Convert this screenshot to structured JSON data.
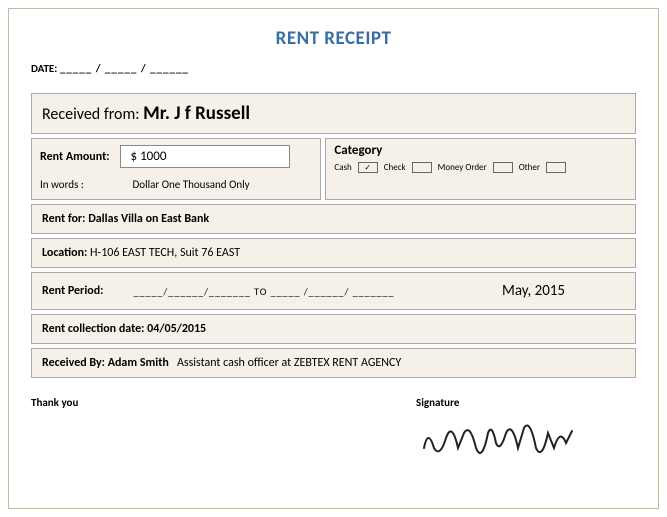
{
  "title": "RENT RECEIPT",
  "date_label": "DATE:",
  "date_blanks": "_____ / _____ / ______",
  "received_from": {
    "label": "Received from:",
    "value": "Mr. J f Russell"
  },
  "amount": {
    "label": "Rent Amount:",
    "value": "$ 1000",
    "words_label": "In words :",
    "words_value": "Dollar One Thousand Only"
  },
  "category": {
    "title": "Category",
    "options": [
      {
        "label": "Cash",
        "checked": true
      },
      {
        "label": "Check",
        "checked": false
      },
      {
        "label": "Money Order",
        "checked": false
      },
      {
        "label": "Other",
        "checked": false
      }
    ]
  },
  "rent_for": {
    "label": "Rent for:",
    "value": "Dallas Villa on East Bank"
  },
  "location": {
    "label": "Location:",
    "value": "H-106 EAST TECH,  Suit 76 EAST"
  },
  "period": {
    "label": "Rent Period:",
    "blanks": "_____/______/_______   TO   _____ /______/ _______",
    "month": "May, 2015"
  },
  "collection": {
    "label": "Rent collection date:",
    "value": "04/05/2015"
  },
  "received_by": {
    "label": "Received By:",
    "name": "Adam Smith",
    "role": "Assistant cash officer at ZEBTEX  RENT  AGENCY"
  },
  "thank": "Thank you",
  "signature_label": "Signature"
}
